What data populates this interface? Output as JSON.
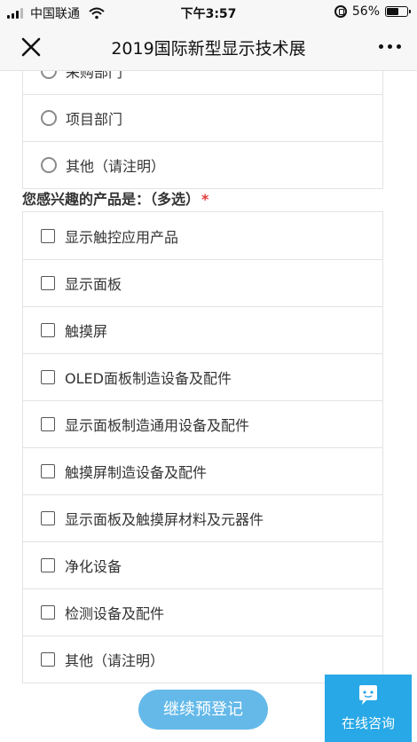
{
  "status_bar": {
    "carrier": "中国联通",
    "time": "下午3:57",
    "battery": "56%",
    "battery_level": 0.56
  },
  "nav": {
    "title": "2019国际新型显示技术展",
    "close_icon": "close-icon",
    "more_icon": "more-icon"
  },
  "department_options": [
    {
      "label": "采购部门"
    },
    {
      "label": "项目部门"
    },
    {
      "label": "其他（请注明）"
    }
  ],
  "products_question": {
    "label": "您感兴趣的产品是：（多选）",
    "required_mark": "*",
    "options": [
      {
        "label": "显示触控应用产品"
      },
      {
        "label": "显示面板"
      },
      {
        "label": "触摸屏"
      },
      {
        "label": "OLED面板制造设备及配件"
      },
      {
        "label": "显示面板制造通用设备及配件"
      },
      {
        "label": "触摸屏制造设备及配件"
      },
      {
        "label": "显示面板及触摸屏材料及元器件"
      },
      {
        "label": "净化设备"
      },
      {
        "label": "检测设备及配件"
      },
      {
        "label": "其他（请注明）"
      }
    ]
  },
  "actions": {
    "submit_label": "继续预登记",
    "consult_label": "在线咨询"
  },
  "colors": {
    "submit_bg": "#64b9e9",
    "consult_bg": "#28a8e6",
    "required": "#e23b3b"
  }
}
